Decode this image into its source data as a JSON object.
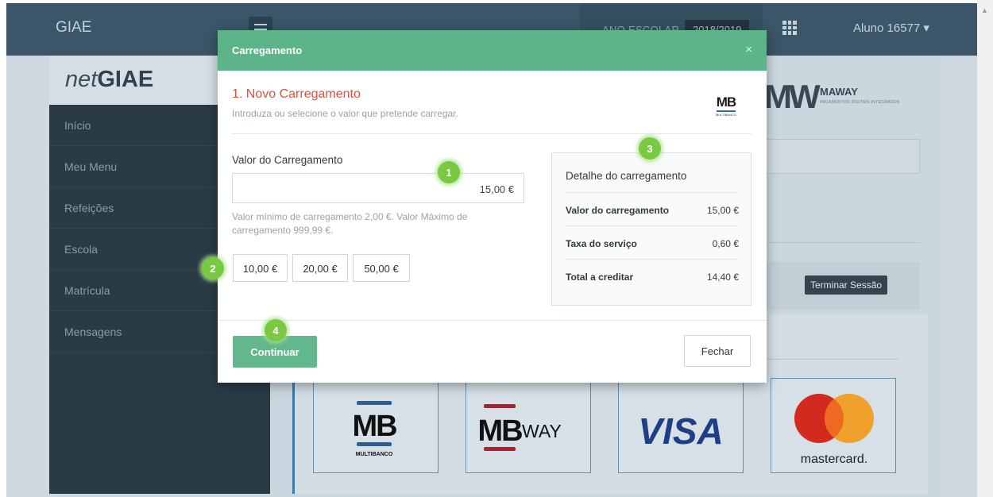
{
  "topbar": {
    "app_title": "GIAE",
    "year_label": "ANO ESCOLAR",
    "year_value": "2018/2019",
    "user_label": "Aluno 16577 ▾"
  },
  "brand": {
    "net": "net",
    "giae": "GIAE"
  },
  "sidebar": {
    "items": [
      {
        "label": "Início"
      },
      {
        "label": "Meu Menu"
      },
      {
        "label": "Refeições"
      },
      {
        "label": "Escola"
      },
      {
        "label": "Matrícula"
      },
      {
        "label": "Mensagens"
      }
    ]
  },
  "partner_logo": {
    "mark": "MW",
    "name": "MAWAY",
    "tagline": "PAGAMENTOS DIGITAIS INTEGRADOS"
  },
  "logout_label": "Terminar Sessão",
  "payment_methods": [
    {
      "name": "MB",
      "sub": "MULTIBANCO"
    },
    {
      "name": "MB",
      "extra": "WAY"
    },
    {
      "name": "VISA"
    },
    {
      "name": "mastercard."
    }
  ],
  "modal": {
    "title": "Carregamento",
    "close_glyph": "×",
    "step_title": "1. Novo Carregamento",
    "step_desc": "Introduza ou selecione o valor que pretende carregar.",
    "mb_logo": {
      "mark": "MB",
      "sub": "MULTIBANCO"
    },
    "amount_label": "Valor do Carregamento",
    "amount_value": "15,00 €",
    "amount_hint": "Valor mínimo de carregamento 2,00 €. Valor Máximo de carregamento 999,99 €.",
    "presets": [
      "10,00 €",
      "20,00 €",
      "50,00 €"
    ],
    "detail": {
      "title": "Detalhe do carregamento",
      "rows": [
        {
          "label": "Valor do carregamento",
          "value": "15,00 €"
        },
        {
          "label": "Taxa do serviço",
          "value": "0,60 €"
        },
        {
          "label": "Total a creditar",
          "value": "14,40 €"
        }
      ]
    },
    "continue_label": "Continuar",
    "close_label": "Fechar"
  },
  "callouts": [
    "1",
    "2",
    "3",
    "4"
  ],
  "colors": {
    "modal_header": "#5eb489",
    "step_title": "#d9533d",
    "callout": "#7ac943",
    "topbar": "#3b5668",
    "sidebar": "#2a3b46"
  }
}
